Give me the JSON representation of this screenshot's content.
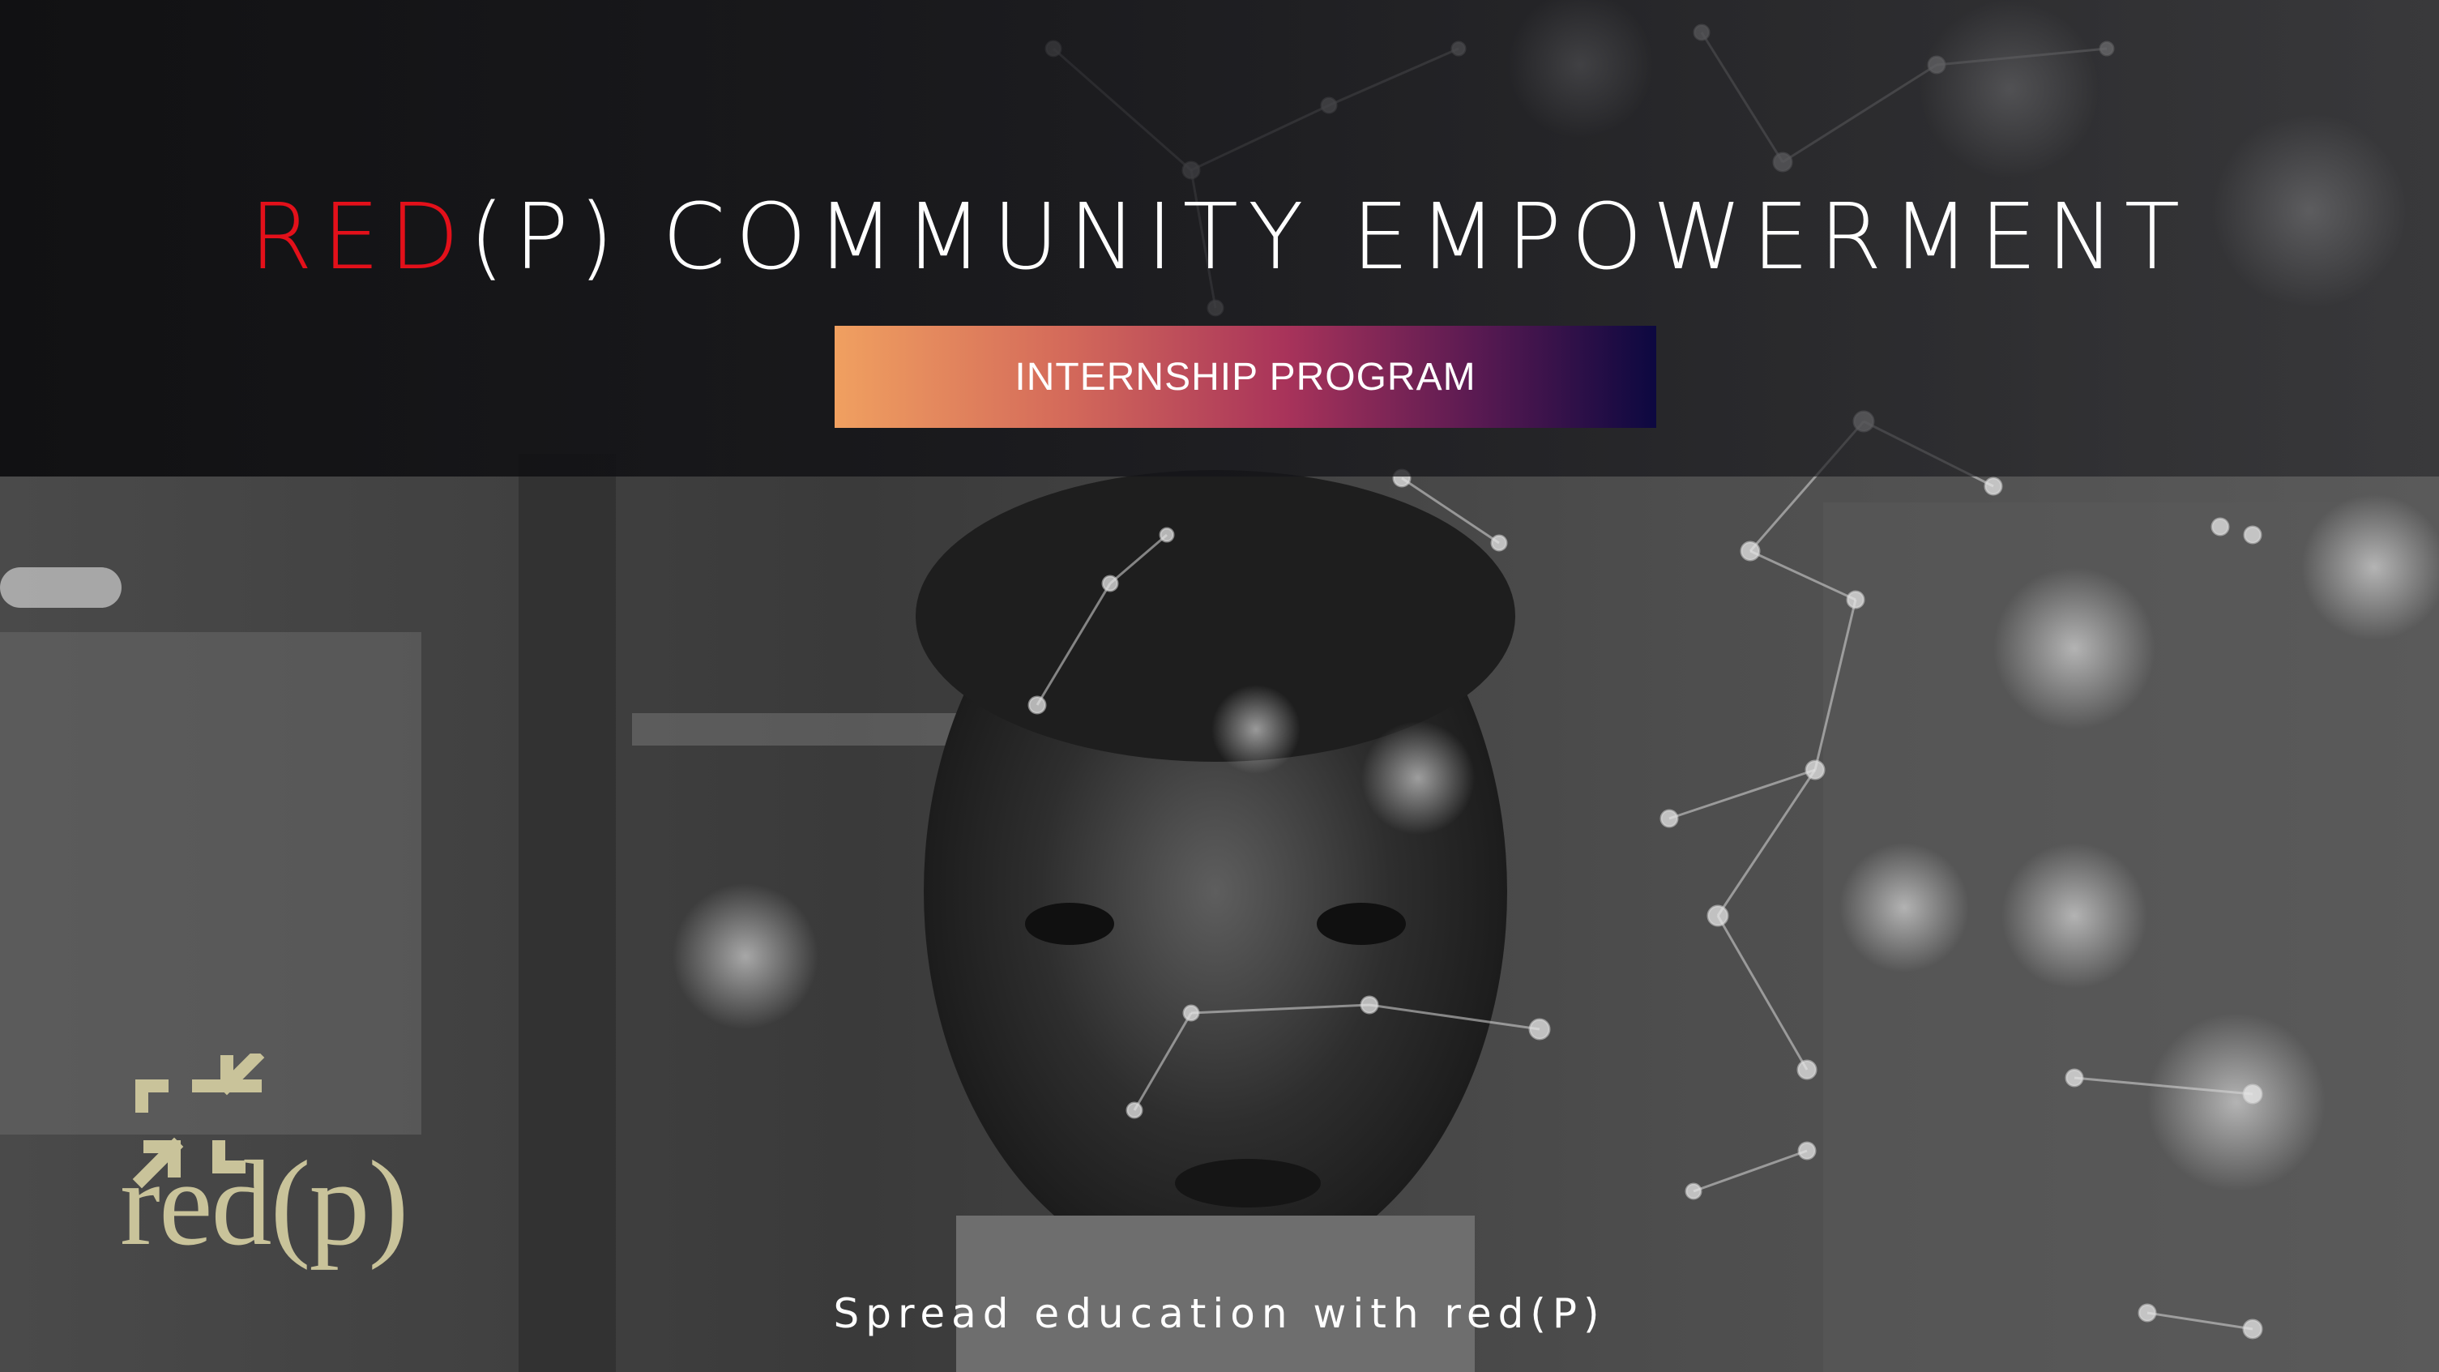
{
  "slide": {
    "title_accent": "RED",
    "title_rest": "(P) COMMUNITY EMPOWERMENT",
    "badge_label": "INTERNSHIP PROGRAM",
    "tagline": "Spread education with red(P)",
    "logo_text": "red(p)"
  },
  "colors": {
    "accent_red": "#e3101a",
    "logo_olive": "#c9c39a",
    "badge_gradient": [
      "#f0a060",
      "#a8335a",
      "#0c0840"
    ]
  },
  "icons": [
    "network-overlay",
    "compress-arrows-icon"
  ]
}
